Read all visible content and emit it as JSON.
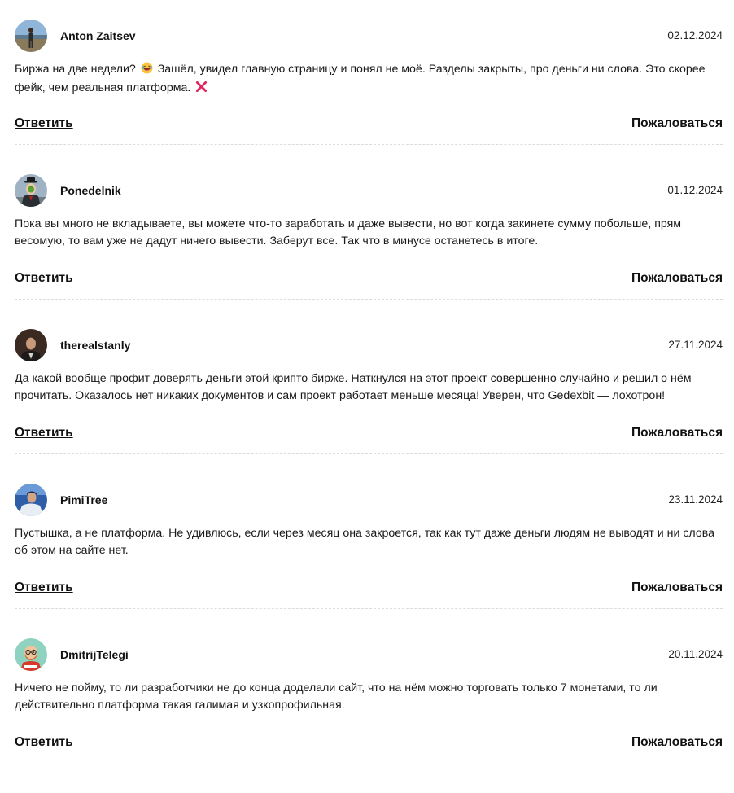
{
  "actions": {
    "reply_label": "Ответить",
    "report_label": "Пожаловаться"
  },
  "comments": [
    {
      "author": "Anton Zaitsev",
      "date": "02.12.2024",
      "text_before": "Биржа на две недели? ",
      "text_middle": " Зашёл, увидел главную страницу и понял не моё. Разделы закрыты, про деньги ни слова. Это скорее фейк, чем реальная платформа. ",
      "emojis": [
        "laughing-emoji",
        "cross-mark-emoji"
      ]
    },
    {
      "author": "Ponedelnik",
      "date": "01.12.2024",
      "text": "Пока вы много не вкладываете, вы можете что-то заработать и даже вывести, но вот когда закинете сумму побольше, прям весомую, то вам уже не дадут ничего вывести. Заберут все. Так что в минусе останетесь в итоге."
    },
    {
      "author": "therealstanly",
      "date": "27.11.2024",
      "text": "Да какой вообще профит доверять деньги этой крипто бирже. Наткнулся на этот проект совершенно случайно и решил о нём прочитать. Оказалось нет никаких документов и сам проект работает меньше месяца! Уверен, что Gedexbit — лохотрон!"
    },
    {
      "author": "PimiTree",
      "date": "23.11.2024",
      "text": "Пустышка, а не платформа. Не удивлюсь, если через месяц она закроется, так как тут даже деньги людям не выводят и ни слова об этом на сайте нет."
    },
    {
      "author": "DmitrijTelegi",
      "date": "20.11.2024",
      "text": "Ничего не пойму, то ли разработчики не до конца доделали сайт, что на нём можно торговать только 7 монетами, то ли действительно платформа такая галимая и узкопрофильная."
    }
  ]
}
